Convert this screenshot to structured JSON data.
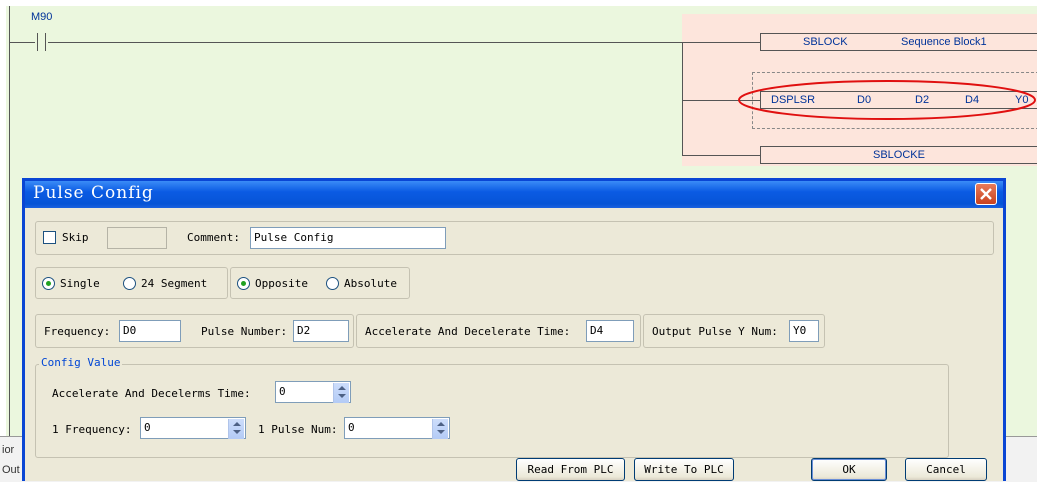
{
  "ladder": {
    "contact_label": "M90",
    "rows": [
      {
        "op": "SBLOCK",
        "args": [
          "Sequence Block1"
        ]
      },
      {
        "op": "DSPLSR",
        "args": [
          "D0",
          "D2",
          "D4",
          "Y0"
        ]
      },
      {
        "op": "SBLOCKE",
        "args": []
      }
    ]
  },
  "status_strip": {
    "line1": "ior",
    "line2": "Out"
  },
  "dialog": {
    "title": "Pulse Config",
    "skip_label": "Skip",
    "skip_value": "",
    "comment_label": "Comment:",
    "comment_value": "Pulse Config",
    "mode_single": "Single",
    "mode_24": "24 Segment",
    "dir_opposite": "Opposite",
    "dir_absolute": "Absolute",
    "frequency_label": "Frequency:",
    "frequency_value": "D0",
    "pulse_number_label": "Pulse Number:",
    "pulse_number_value": "D2",
    "acc_dec_label": "Accelerate And Decelerate Time:",
    "acc_dec_value": "D4",
    "output_label": "Output Pulse Y Num:",
    "output_value": "Y0",
    "config_legend": "Config Value",
    "acc_dec_ms_label": "Accelerate And Decelerms Time:",
    "acc_dec_ms_value": "0",
    "freq1_label": "1 Frequency:",
    "freq1_value": "0",
    "pulse1_label": "1 Pulse Num:",
    "pulse1_value": "0",
    "read_btn": "Read From PLC",
    "write_btn": "Write To PLC",
    "ok_btn": "OK",
    "cancel_btn": "Cancel"
  },
  "colors": {
    "ladder_green": "#ebf7de",
    "ladder_pink": "#fde5dc",
    "highlight_ellipse": "#e01010",
    "title_blue": "#0654d6"
  }
}
